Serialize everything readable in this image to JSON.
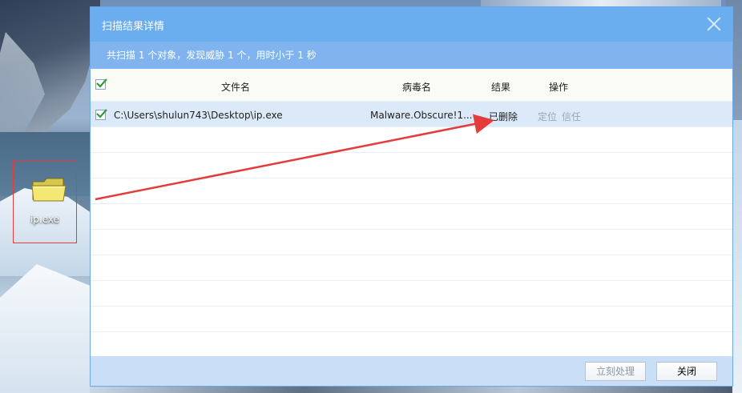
{
  "desktop": {
    "icon_label": "ip.exe",
    "icon_name": "folder-icon"
  },
  "dialog": {
    "title": "扫描结果详情",
    "summary": "共扫描 1 个对象，发现威胁 1 个，用时小于 1 秒",
    "columns": {
      "filename": "文件名",
      "virus": "病毒名",
      "result": "结果",
      "action": "操作"
    },
    "rows": [
      {
        "checked": true,
        "path": "C:\\Users\\shulun743\\Desktop\\ip.exe",
        "virus": "Malware.Obscure!1...",
        "result": "已删除",
        "action_locate": "定位",
        "action_trust": "信任"
      }
    ],
    "buttons": {
      "process": "立刻处理",
      "close": "关闭"
    }
  },
  "colors": {
    "titlebar": "#6aaef0",
    "summary_bar": "#81b4ee",
    "footer": "#c9def7",
    "highlight_red": "#e43b3b"
  }
}
